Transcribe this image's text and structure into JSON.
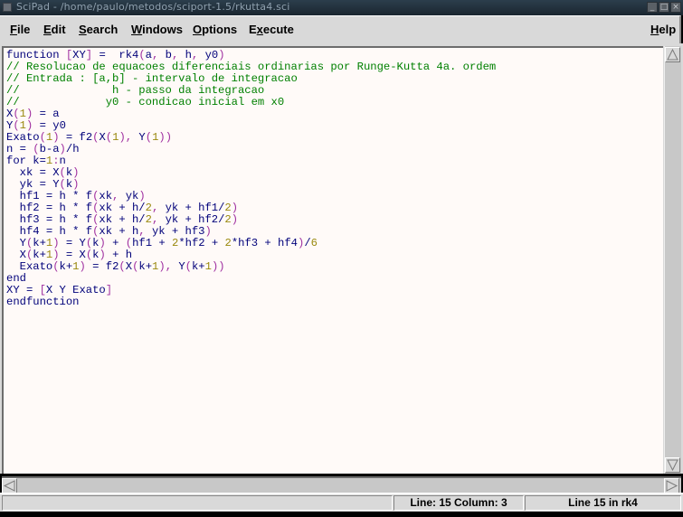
{
  "window": {
    "title": "SciPad - /home/paulo/metodos/sciport-1.5/rkutta4.sci",
    "buttons": [
      "minimize",
      "maximize",
      "close"
    ]
  },
  "menubar": {
    "items": [
      {
        "label_first": "F",
        "label_rest": "ile"
      },
      {
        "label_first": "E",
        "label_rest": "dit"
      },
      {
        "label_first": "S",
        "label_rest": "earch"
      },
      {
        "label_first": "W",
        "label_rest": "indows"
      },
      {
        "label_first": "O",
        "label_rest": "ptions"
      },
      {
        "label_pre": "E",
        "label_first": "x",
        "label_rest": "ecute"
      }
    ],
    "help": {
      "label_first": "H",
      "label_rest": "elp"
    }
  },
  "editor": {
    "lines": [
      "function [XY] =  rk4(a, b, h, y0)",
      "// Resolucao de equacoes diferenciais ordinarias por Runge-Kutta 4a. ordem",
      "// Entrada : [a,b] - intervalo de integracao",
      "//              h - passo da integracao",
      "//             y0 - condicao inicial em x0",
      "X(1) = a",
      "Y(1) = y0",
      "Exato(1) = f2(X(1), Y(1))",
      "n = (b-a)/h",
      "for k=1:n",
      "  xk = X(k)",
      "  yk = Y(k)",
      "  hf1 = h * f(xk, yk)",
      "  hf2 = h * f(xk + h/2, yk + hf1/2)",
      "  hf3 = h * f(xk + h/2, yk + hf2/2)",
      "  hf4 = h * f(xk + h, yk + hf3)",
      "  Y(k+1) = Y(k) + (hf1 + 2*hf2 + 2*hf3 + hf4)/6",
      "  X(k+1) = X(k) + h",
      "  Exato(k+1) = f2(X(k+1), Y(k+1))",
      "end",
      "XY = [X Y Exato]",
      "endfunction"
    ],
    "syntax_colors": {
      "text": "#00007a",
      "comment": "#008000",
      "bracket": "#a030a0",
      "number": "#9b8a10"
    }
  },
  "statusbar": {
    "position": "Line: 15   Column: 3",
    "function_location": "Line 15 in rk4"
  }
}
